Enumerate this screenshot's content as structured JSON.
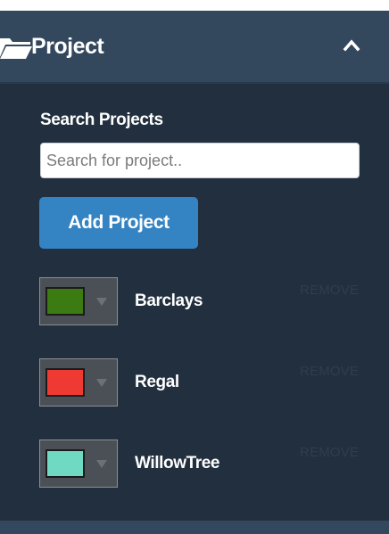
{
  "header": {
    "title": "Project",
    "icon": "folder-open-icon",
    "toggle_icon": "chevron-up-icon"
  },
  "search": {
    "label": "Search Projects",
    "placeholder": "Search for project..",
    "value": ""
  },
  "add_button": {
    "label": "Add Project"
  },
  "projects": [
    {
      "name": "Barclays",
      "color": "#3c7a12",
      "remove_label": "REMOVE"
    },
    {
      "name": "Regal",
      "color": "#ee3a32",
      "remove_label": "REMOVE"
    },
    {
      "name": "WillowTree",
      "color": "#6fd9c4",
      "remove_label": "REMOVE"
    }
  ],
  "colors": {
    "panel_bg": "#222f3e",
    "header_bg": "#33475d",
    "button_bg": "#3483c3",
    "remove_text": "#2e3e50"
  }
}
